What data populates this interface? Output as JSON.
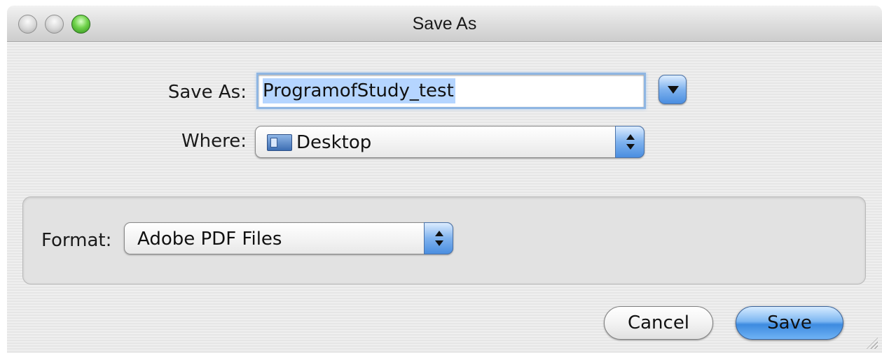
{
  "window": {
    "title": "Save As"
  },
  "save_as": {
    "label": "Save As:",
    "value": "ProgramofStudy_test"
  },
  "where": {
    "label": "Where:",
    "selected": "Desktop",
    "icon": "desktop-folder-icon"
  },
  "format": {
    "label": "Format:",
    "selected": "Adobe PDF Files"
  },
  "buttons": {
    "cancel": "Cancel",
    "save": "Save"
  },
  "colors": {
    "accent": "#4a8ee0",
    "selection": "#b5d5ff",
    "focus_ring": "#8fb6e2"
  }
}
